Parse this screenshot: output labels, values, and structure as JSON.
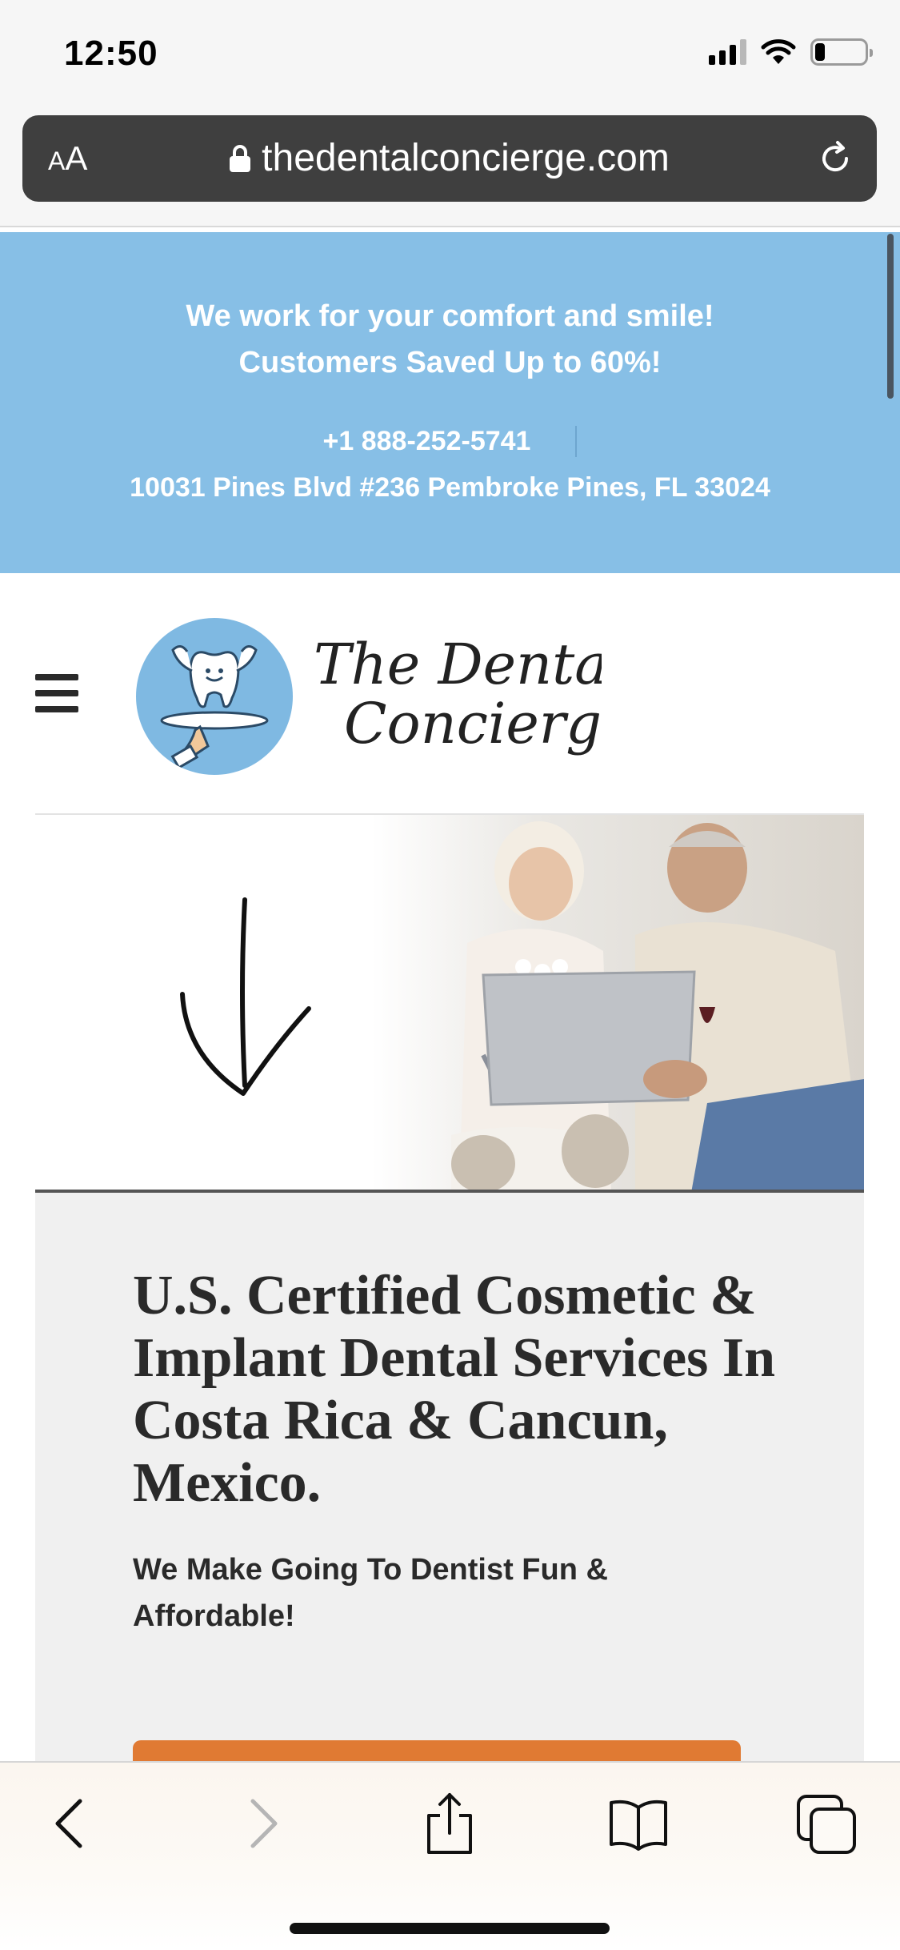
{
  "status_bar": {
    "time": "12:50",
    "signal_bars_active": 3,
    "signal_bars_total": 4,
    "battery_level": 0.2
  },
  "browser": {
    "text_size_button": "AA",
    "url": "thedentalconcierge.com",
    "lock_icon": "lock-icon",
    "reload_icon": "reload-icon"
  },
  "banner": {
    "tagline_line1": "We work for your comfort and smile!",
    "tagline_line2": "Customers Saved Up to 60%!",
    "phone": "+1 888-252-5741",
    "address": "10031 Pines Blvd #236 Pembroke Pines, FL 33024",
    "background_color": "#87bfe6"
  },
  "header": {
    "menu_icon": "hamburger-menu-icon",
    "logo_script_line1": "The Dental",
    "logo_script_line2": "Concierge"
  },
  "hero": {
    "arrow_icon": "hand-drawn-down-arrow",
    "photo": "smiling-senior-couple-with-laptop"
  },
  "content": {
    "headline": "U.S. Certified Cosmetic & Implant Dental Services In Costa Rica & Cancun, Mexico.",
    "subheadline": "We Make Going To Dentist Fun & Affordable!",
    "cta_color": "#e07a33"
  },
  "toolbar": {
    "back_icon": "chevron-left-icon",
    "forward_icon": "chevron-right-icon",
    "share_icon": "share-icon",
    "bookmarks_icon": "book-icon",
    "tabs_icon": "tabs-icon"
  }
}
